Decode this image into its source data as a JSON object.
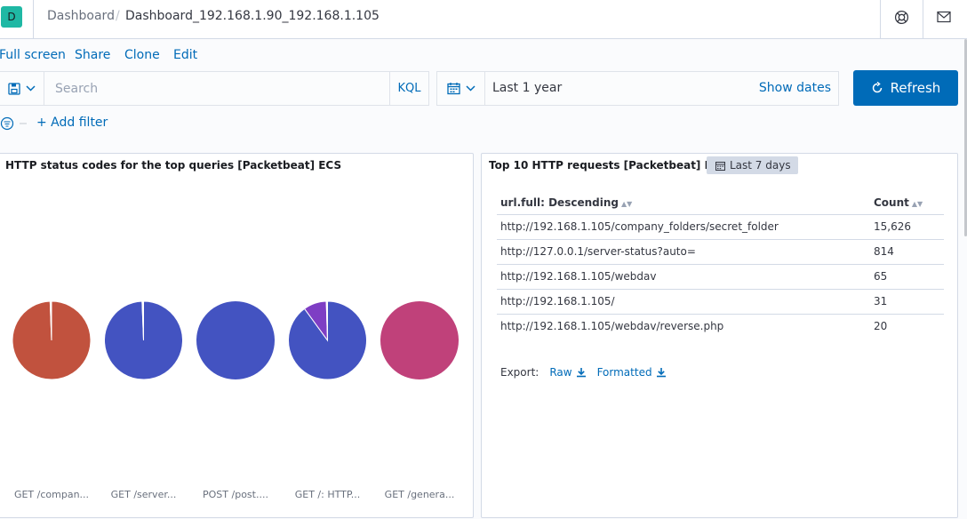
{
  "header": {
    "space_initial": "D",
    "breadcrumb_root": "Dashboard",
    "breadcrumb_separator": "/",
    "breadcrumb_current": "Dashboard_192.168.1.90_192.168.1.105",
    "icons": [
      "help-icon",
      "mail-icon"
    ]
  },
  "nav": {
    "fullscreen": "Full screen",
    "share": "Share",
    "clone": "Clone",
    "edit": "Edit"
  },
  "query": {
    "placeholder": "Search",
    "language": "KQL",
    "time_range": "Last 1 year",
    "show_dates": "Show dates",
    "refresh": "Refresh",
    "add_filter": "+ Add filter"
  },
  "panel_left": {
    "title": "HTTP status codes for the top queries [Packetbeat] ECS",
    "pies": [
      {
        "label": "GET /compan...",
        "slices": [
          {
            "value": 99.4,
            "color": "#c1523e"
          },
          {
            "value": 0.6,
            "color": "#ffffff"
          }
        ]
      },
      {
        "label": "GET /server...",
        "slices": [
          {
            "value": 99.4,
            "color": "#4353c1"
          },
          {
            "value": 0.6,
            "color": "#ffffff"
          }
        ]
      },
      {
        "label": "POST /post....",
        "slices": [
          {
            "value": 100,
            "color": "#4353c1"
          }
        ]
      },
      {
        "label": "GET /: HTTP...",
        "slices": [
          {
            "value": 90,
            "color": "#4353c1"
          },
          {
            "value": 9.5,
            "color": "#7e3ec4"
          },
          {
            "value": 0.5,
            "color": "#ffffff"
          }
        ]
      },
      {
        "label": "GET /genera...",
        "slices": [
          {
            "value": 100,
            "color": "#c0417a"
          }
        ]
      }
    ]
  },
  "panel_right": {
    "title": "Top 10 HTTP requests [Packetbeat] ECS",
    "time_badge": "Last 7 days",
    "col_url": "url.full: Descending",
    "col_count": "Count",
    "rows": [
      {
        "url": "http://192.168.1.105/company_folders/secret_folder",
        "count": "15,626"
      },
      {
        "url": "http://127.0.0.1/server-status?auto=",
        "count": "814"
      },
      {
        "url": "http://192.168.1.105/webdav",
        "count": "65"
      },
      {
        "url": "http://192.168.1.105/",
        "count": "31"
      },
      {
        "url": "http://192.168.1.105/webdav/reverse.php",
        "count": "20"
      }
    ],
    "export_label": "Export:",
    "export_raw": "Raw",
    "export_formatted": "Formatted"
  },
  "colors": {
    "accent": "#006bb8",
    "space_badge": "#1fb8a4"
  }
}
